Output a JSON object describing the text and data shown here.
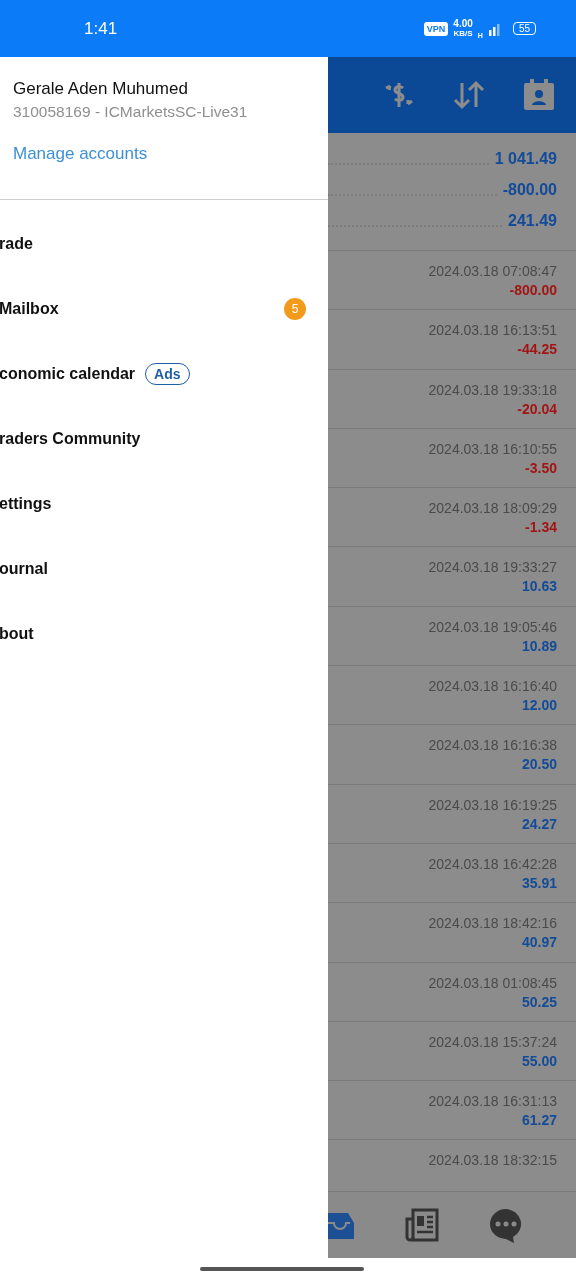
{
  "status_bar": {
    "time": "1:41",
    "vpn": "VPN",
    "speed": "4.00",
    "speed_unit": "KB/S",
    "network": "H",
    "battery": "55"
  },
  "drawer": {
    "name": "Gerale Aden Muhumed",
    "account": "310058169 - ICMarketsSC-Live31",
    "manage": "Manage accounts",
    "items": [
      {
        "label": "rade"
      },
      {
        "label": "Mailbox",
        "badge": "5"
      },
      {
        "label": "conomic calendar",
        "tag": "Ads"
      },
      {
        "label": "raders Community"
      },
      {
        "label": "ettings"
      },
      {
        "label": "ournal"
      },
      {
        "label": "bout"
      }
    ]
  },
  "summary": [
    "1 041.49",
    "-800.00",
    "241.49"
  ],
  "deals": [
    {
      "time": "2024.03.18 07:08:47",
      "amount": "-800.00",
      "color": "#a31515"
    },
    {
      "time": "2024.03.18 16:13:51",
      "amount": "-44.25",
      "color": "#a31515"
    },
    {
      "time": "2024.03.18 19:33:18",
      "amount": "-20.04",
      "color": "#a31515"
    },
    {
      "time": "2024.03.18 16:10:55",
      "amount": "-3.50",
      "color": "#a31515"
    },
    {
      "time": "2024.03.18 18:09:29",
      "amount": "-1.34",
      "color": "#a31515"
    },
    {
      "time": "2024.03.18 19:33:27",
      "amount": "10.63",
      "color": "#124b99"
    },
    {
      "time": "2024.03.18 19:05:46",
      "amount": "10.89",
      "color": "#124b99"
    },
    {
      "time": "2024.03.18 16:16:40",
      "amount": "12.00",
      "color": "#124b99"
    },
    {
      "time": "2024.03.18 16:16:38",
      "amount": "20.50",
      "color": "#124b99"
    },
    {
      "time": "2024.03.18 16:19:25",
      "amount": "24.27",
      "color": "#124b99"
    },
    {
      "time": "2024.03.18 16:42:28",
      "amount": "35.91",
      "color": "#124b99"
    },
    {
      "time": "2024.03.18 18:42:16",
      "amount": "40.97",
      "color": "#124b99"
    },
    {
      "time": "2024.03.18 01:08:45",
      "amount": "50.25",
      "color": "#124b99"
    },
    {
      "time": "2024.03.18 15:37:24",
      "amount": "55.00",
      "color": "#124b99"
    },
    {
      "time": "2024.03.18 16:31:13",
      "amount": "61.27",
      "color": "#124b99"
    },
    {
      "time": "2024.03.18 18:32:15"
    }
  ]
}
